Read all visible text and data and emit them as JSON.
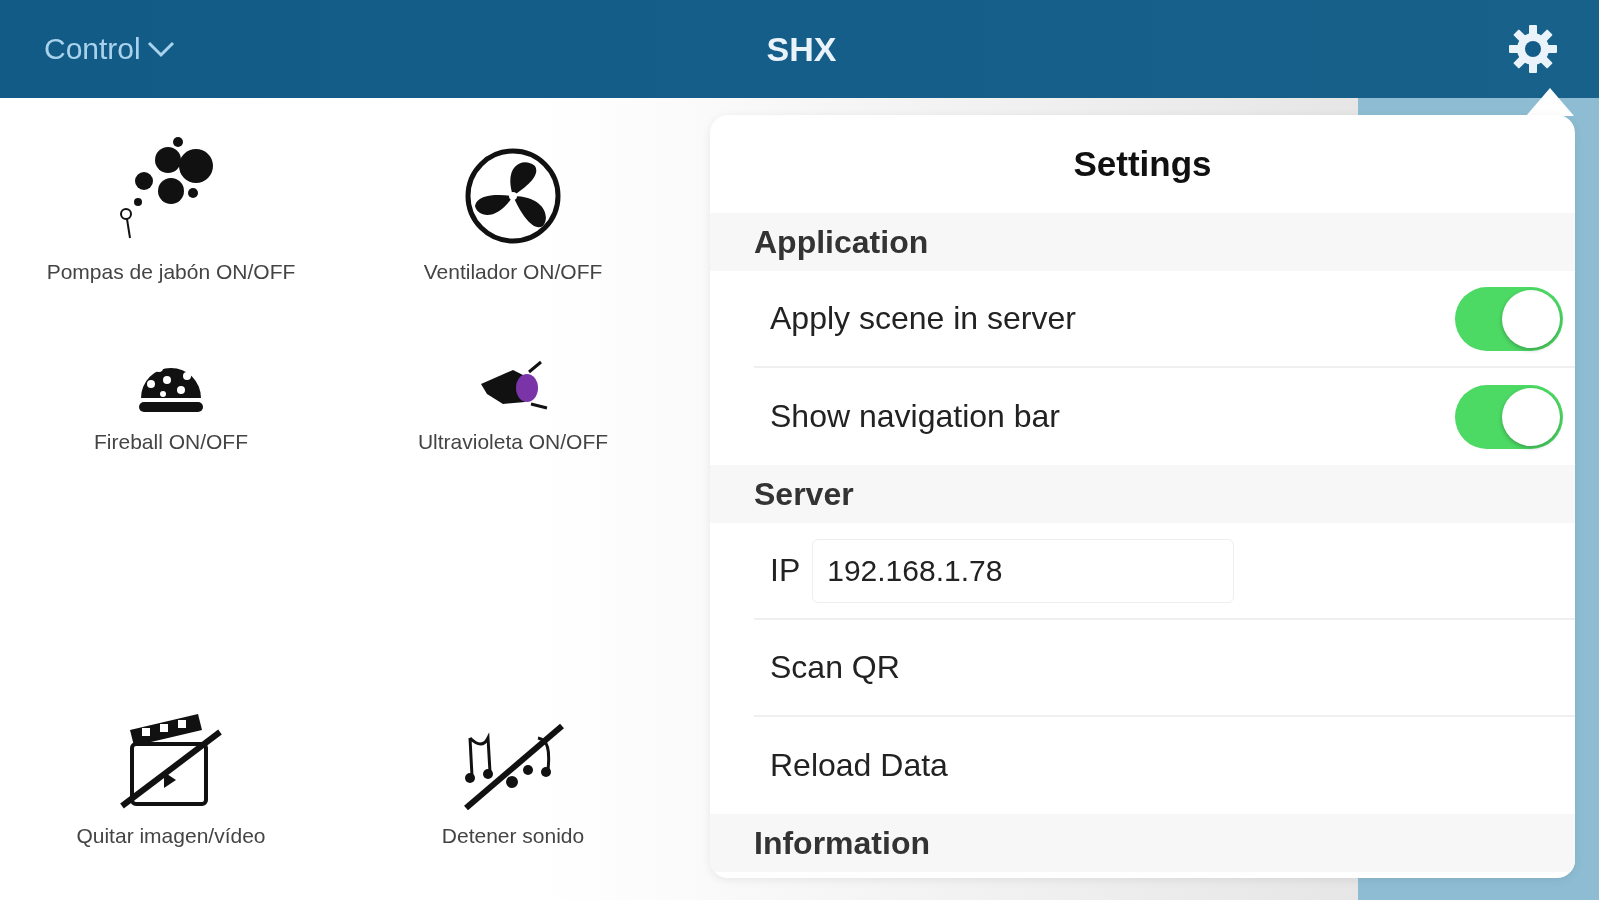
{
  "header": {
    "menu": "Control",
    "title": "SHX"
  },
  "tile_rows": [
    [
      {
        "kind": "bubbles",
        "label": "Pompas de jabón ON/OFF"
      },
      {
        "kind": "fan",
        "label": "Ventilador ON/OFF"
      }
    ],
    [
      {
        "kind": "ball",
        "label": "Fireball ON/OFF"
      },
      {
        "kind": "uv",
        "label": "Ultravioleta ON/OFF"
      }
    ],
    [
      {
        "kind": "novideo",
        "label": "Quitar imagen/vídeo"
      },
      {
        "kind": "nosound",
        "label": "Detener sonido"
      }
    ]
  ],
  "settings": {
    "title": "Settings",
    "sections": [
      {
        "header": "Application",
        "rows": [
          {
            "kind": "toggle",
            "label": "Apply scene in server",
            "on": true
          },
          {
            "kind": "toggle",
            "label": "Show navigation bar",
            "on": true
          }
        ]
      },
      {
        "header": "Server",
        "rows": [
          {
            "kind": "field",
            "label": "IP",
            "value": "192.168.1.78"
          },
          {
            "kind": "action",
            "label": "Scan QR"
          },
          {
            "kind": "action",
            "label": "Reload Data"
          }
        ]
      },
      {
        "header": "Information"
      }
    ]
  }
}
